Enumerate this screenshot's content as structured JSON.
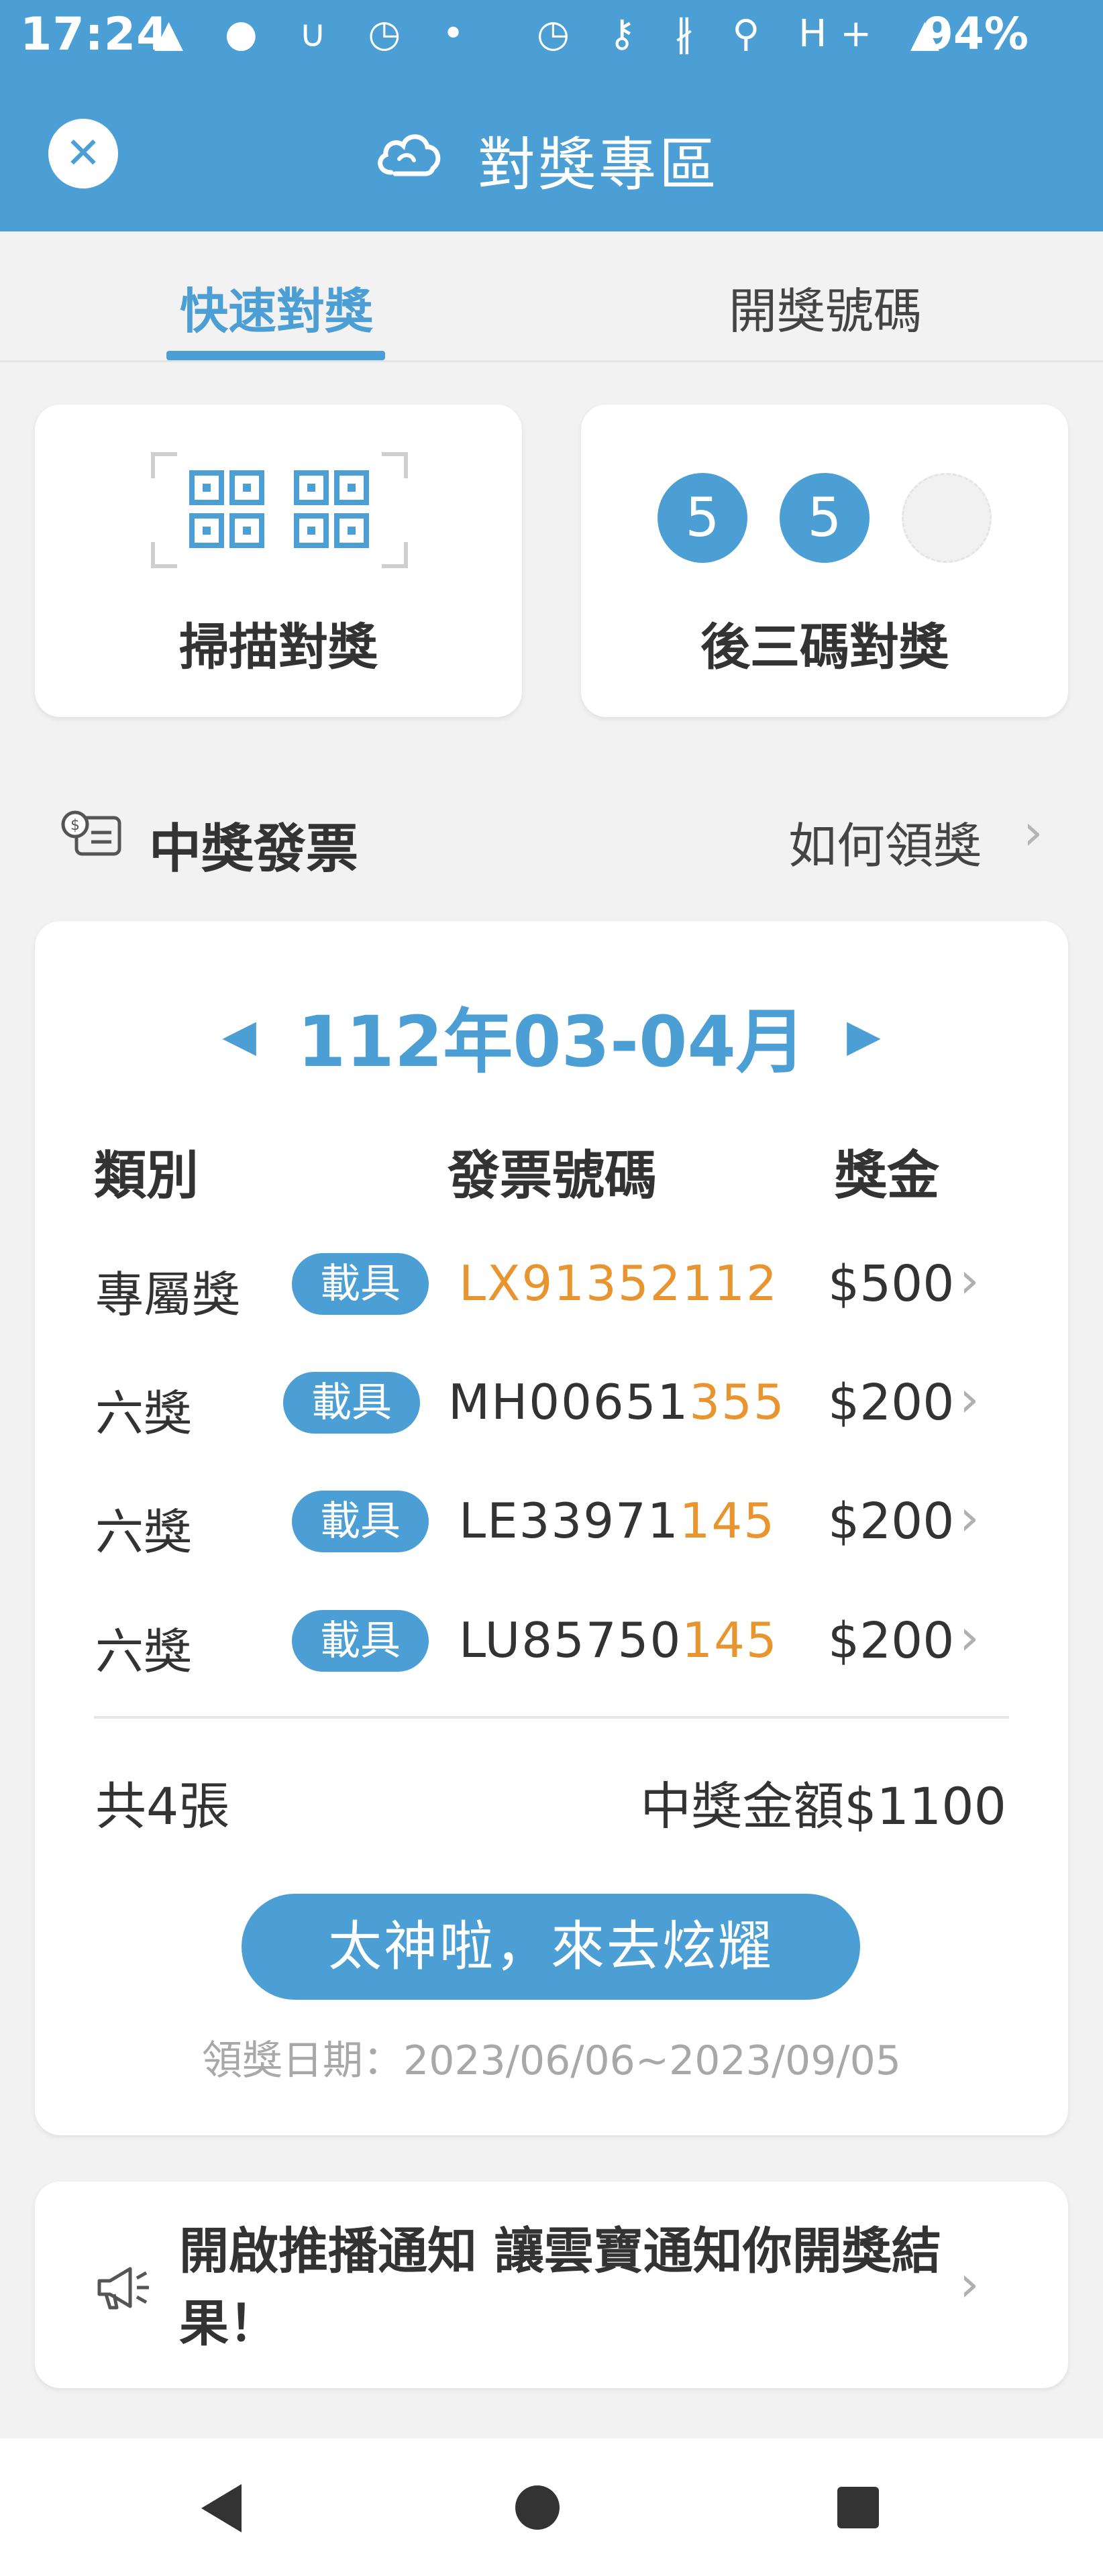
{
  "status_bar": {
    "time": "17:24",
    "left_icons": "▲ ● ∪ ◷ •",
    "right_icons": "◷ ⚷ ∦ ⚲ H+ ▲",
    "battery": "94%"
  },
  "header": {
    "title": "對獎專區",
    "close_icon": "close-icon",
    "logo_icon": "cloud-icon"
  },
  "tabs": [
    {
      "label": "快速對獎",
      "active": true
    },
    {
      "label": "開獎號碼",
      "active": false
    }
  ],
  "quick_actions": {
    "scan_label": "掃描對獎",
    "last3_label": "後三碼對獎",
    "last3_digits": [
      "5",
      "5",
      ""
    ]
  },
  "winning_section": {
    "title": "中獎發票",
    "how_to_claim": "如何領獎",
    "period": "112年03-04月",
    "columns": {
      "category": "類別",
      "number": "發票號碼",
      "prize": "獎金"
    },
    "rows": [
      {
        "category": "專屬獎",
        "badge": "載具",
        "number_prefix": "",
        "number_match": "LX91352112",
        "amount": "$500"
      },
      {
        "category": "六獎",
        "badge": "載具",
        "number_prefix": "MH00651",
        "number_match": "355",
        "amount": "$200"
      },
      {
        "category": "六獎",
        "badge": "載具",
        "number_prefix": "LE33971",
        "number_match": "145",
        "amount": "$200"
      },
      {
        "category": "六獎",
        "badge": "載具",
        "number_prefix": "LU85750",
        "number_match": "145",
        "amount": "$200"
      }
    ],
    "count": "共4張",
    "total": "中獎金額$1100",
    "brag_button": "太神啦，來去炫耀",
    "claim_date": "領獎日期：2023/06/06~2023/09/05"
  },
  "push_card": {
    "text": "開啟推播通知 讓雲寶通知你開獎結果！"
  },
  "colors": {
    "primary": "#4c9fd4",
    "highlight": "#e8952f",
    "background": "#f2f2f2"
  }
}
